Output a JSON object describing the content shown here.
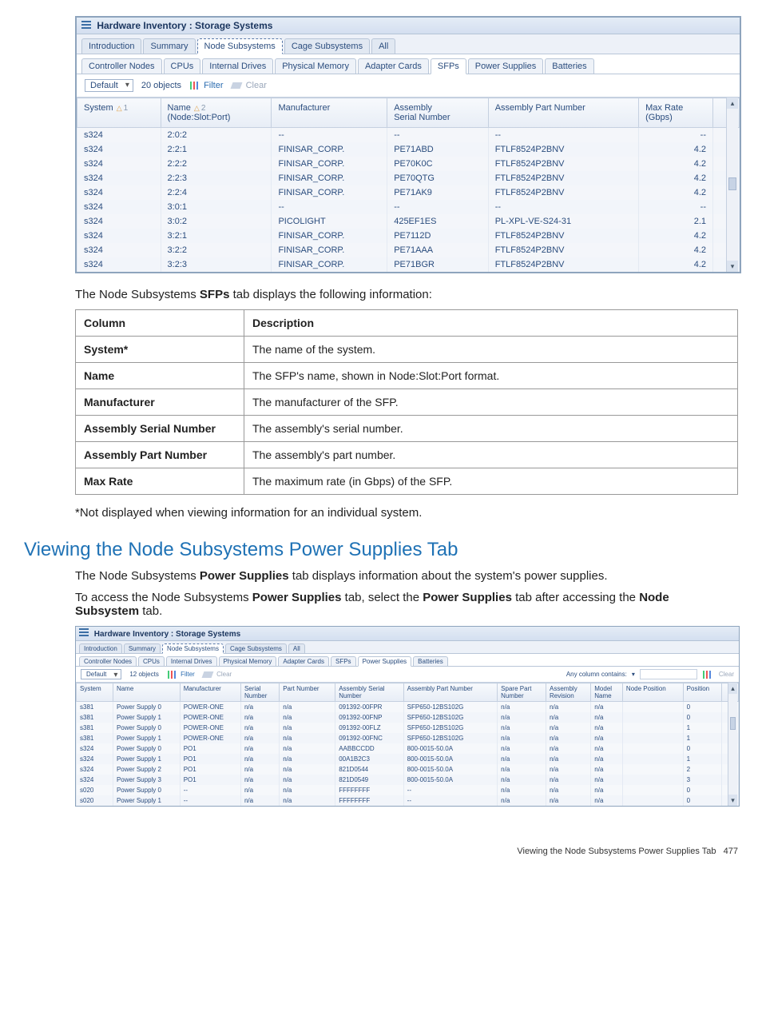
{
  "screenshot1": {
    "title": "Hardware Inventory : Storage Systems",
    "topTabs": [
      "Introduction",
      "Summary",
      "Node Subsystems",
      "Cage Subsystems",
      "All"
    ],
    "topActive": "Node Subsystems",
    "subTabs": [
      "Controller Nodes",
      "CPUs",
      "Internal Drives",
      "Physical Memory",
      "Adapter Cards",
      "SFPs",
      "Power Supplies",
      "Batteries"
    ],
    "subActive": "SFPs",
    "toolbar": {
      "preset": "Default",
      "count": "20 objects",
      "filter": "Filter",
      "clear": "Clear"
    },
    "columns": [
      {
        "label": "System",
        "sort": "1"
      },
      {
        "label": "Name\n(Node:Slot:Port)",
        "sort": "2"
      },
      {
        "label": "Manufacturer"
      },
      {
        "label": "Assembly\nSerial Number"
      },
      {
        "label": "Assembly Part Number"
      },
      {
        "label": "Max Rate\n(Gbps)"
      }
    ],
    "rows": [
      [
        "s324",
        "2:0:2",
        "--",
        "--",
        "--",
        "--"
      ],
      [
        "s324",
        "2:2:1",
        "FINISAR_CORP.",
        "PE71ABD",
        "FTLF8524P2BNV",
        "4.2"
      ],
      [
        "s324",
        "2:2:2",
        "FINISAR_CORP.",
        "PE70K0C",
        "FTLF8524P2BNV",
        "4.2"
      ],
      [
        "s324",
        "2:2:3",
        "FINISAR_CORP.",
        "PE70QTG",
        "FTLF8524P2BNV",
        "4.2"
      ],
      [
        "s324",
        "2:2:4",
        "FINISAR_CORP.",
        "PE71AK9",
        "FTLF8524P2BNV",
        "4.2"
      ],
      [
        "s324",
        "3:0:1",
        "--",
        "--",
        "--",
        "--"
      ],
      [
        "s324",
        "3:0:2",
        "PICOLIGHT",
        "425EF1ES",
        "PL-XPL-VE-S24-31",
        "2.1"
      ],
      [
        "s324",
        "3:2:1",
        "FINISAR_CORP.",
        "PE7112D",
        "FTLF8524P2BNV",
        "4.2"
      ],
      [
        "s324",
        "3:2:2",
        "FINISAR_CORP.",
        "PE71AAA",
        "FTLF8524P2BNV",
        "4.2"
      ],
      [
        "s324",
        "3:2:3",
        "FINISAR_CORP.",
        "PE71BGR",
        "FTLF8524P2BNV",
        "4.2"
      ]
    ]
  },
  "caption1_pre": "The Node Subsystems ",
  "caption1_bold": "SFPs",
  "caption1_post": " tab displays the following information:",
  "descTable": {
    "header": [
      "Column",
      "Description"
    ],
    "rows": [
      [
        "System*",
        "The name of the system."
      ],
      [
        "Name",
        "The SFP's name, shown in Node:Slot:Port format."
      ],
      [
        "Manufacturer",
        "The manufacturer of the SFP."
      ],
      [
        "Assembly Serial Number",
        "The assembly's serial number."
      ],
      [
        "Assembly Part Number",
        "The assembly's part number."
      ],
      [
        "Max Rate",
        "The maximum rate (in Gbps) of the SFP."
      ]
    ]
  },
  "footnote": "*Not displayed when viewing information for an individual system.",
  "sectionHeading": "Viewing the Node Subsystems Power Supplies Tab",
  "para2_parts": [
    "The Node Subsystems ",
    "Power Supplies",
    " tab displays information about the system's power supplies."
  ],
  "para3_parts": [
    "To access the Node Subsystems ",
    "Power Supplies",
    " tab, select the ",
    "Power Supplies",
    " tab after accessing the ",
    "Node Subsystem",
    " tab."
  ],
  "screenshot2": {
    "title": "Hardware Inventory : Storage Systems",
    "topTabs": [
      "Introduction",
      "Summary",
      "Node Subsystems",
      "Cage Subsystems",
      "All"
    ],
    "topActive": "Node Subsystems",
    "subTabs": [
      "Controller Nodes",
      "CPUs",
      "Internal Drives",
      "Physical Memory",
      "Adapter Cards",
      "SFPs",
      "Power Supplies",
      "Batteries"
    ],
    "subActive": "Power Supplies",
    "toolbar": {
      "preset": "Default",
      "count": "12 objects",
      "filter": "Filter",
      "clear": "Clear",
      "anycol": "Any column contains:",
      "clear2": "Clear"
    },
    "columns": [
      "System",
      "Name",
      "Manufacturer",
      "Serial\nNumber",
      "Part Number",
      "Assembly Serial\nNumber",
      "Assembly Part Number",
      "Spare Part\nNumber",
      "Assembly\nRevision",
      "Model\nName",
      "Node Position",
      "Position"
    ],
    "rows": [
      [
        "s381",
        "Power Supply 0",
        "POWER-ONE",
        "n/a",
        "n/a",
        "091392-00FPR",
        "SFP650-12BS102G",
        "n/a",
        "n/a",
        "n/a",
        "",
        "0"
      ],
      [
        "s381",
        "Power Supply 1",
        "POWER-ONE",
        "n/a",
        "n/a",
        "091392-00FNP",
        "SFP650-12BS102G",
        "n/a",
        "n/a",
        "n/a",
        "",
        "0"
      ],
      [
        "s381",
        "Power Supply 0",
        "POWER-ONE",
        "n/a",
        "n/a",
        "091392-00FLZ",
        "SFP650-12BS102G",
        "n/a",
        "n/a",
        "n/a",
        "",
        "1"
      ],
      [
        "s381",
        "Power Supply 1",
        "POWER-ONE",
        "n/a",
        "n/a",
        "091392-00FNC",
        "SFP650-12BS102G",
        "n/a",
        "n/a",
        "n/a",
        "",
        "1"
      ],
      [
        "s324",
        "Power Supply 0",
        "PO1",
        "n/a",
        "n/a",
        "AABBCCDD",
        "800-0015-50.0A",
        "n/a",
        "n/a",
        "n/a",
        "",
        "0"
      ],
      [
        "s324",
        "Power Supply 1",
        "PO1",
        "n/a",
        "n/a",
        "00A1B2C3",
        "800-0015-50.0A",
        "n/a",
        "n/a",
        "n/a",
        "",
        "1"
      ],
      [
        "s324",
        "Power Supply 2",
        "PO1",
        "n/a",
        "n/a",
        "821D0544",
        "800-0015-50.0A",
        "n/a",
        "n/a",
        "n/a",
        "",
        "2"
      ],
      [
        "s324",
        "Power Supply 3",
        "PO1",
        "n/a",
        "n/a",
        "821D0549",
        "800-0015-50.0A",
        "n/a",
        "n/a",
        "n/a",
        "",
        "3"
      ],
      [
        "s020",
        "Power Supply 0",
        "--",
        "n/a",
        "n/a",
        "FFFFFFFF",
        "--",
        "n/a",
        "n/a",
        "n/a",
        "",
        "0"
      ],
      [
        "s020",
        "Power Supply 1",
        "--",
        "n/a",
        "n/a",
        "FFFFFFFF",
        "--",
        "n/a",
        "n/a",
        "n/a",
        "",
        "0"
      ]
    ]
  },
  "pageFooterLabel": "Viewing the Node Subsystems Power Supplies Tab",
  "pageNumber": "477"
}
